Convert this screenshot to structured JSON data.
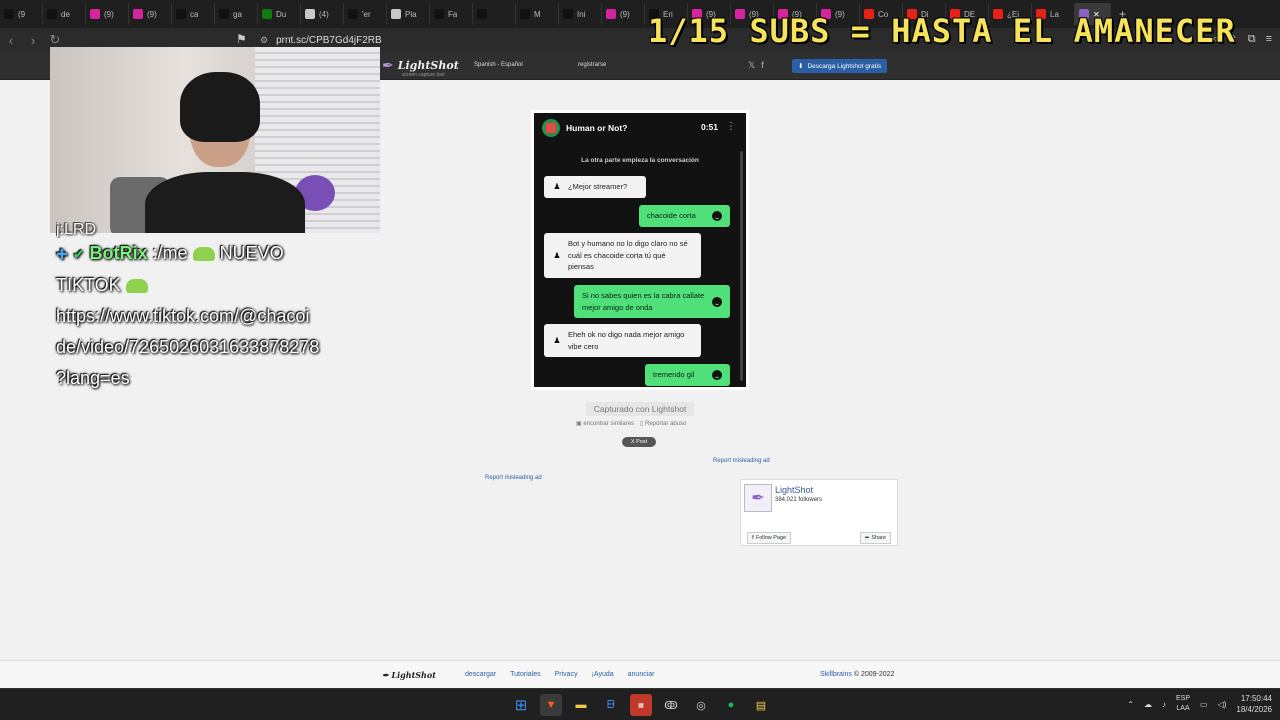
{
  "browser": {
    "tabs": [
      {
        "label": "(9",
        "icon": "tiktok-icon",
        "color": "#111111"
      },
      {
        "label": "de",
        "icon": "x-icon",
        "color": "#111111"
      },
      {
        "label": "(9)",
        "icon": "instagram-icon",
        "color": "#d6249f"
      },
      {
        "label": "(9)",
        "icon": "instagram-icon",
        "color": "#d6249f"
      },
      {
        "label": "ca",
        "icon": "x-icon",
        "color": "#111111"
      },
      {
        "label": "ga",
        "icon": "x-icon",
        "color": "#111111"
      },
      {
        "label": "Du",
        "icon": "xbox-icon",
        "color": "#107c10"
      },
      {
        "label": "(4)",
        "icon": "cloud-icon",
        "color": "#c8c8c8"
      },
      {
        "label": "'er",
        "icon": "x-icon",
        "color": "#111111"
      },
      {
        "label": "Pla",
        "icon": "cloud-icon",
        "color": "#c8c8c8"
      },
      {
        "label": "Fa",
        "icon": "x-icon",
        "color": "#111111"
      },
      {
        "label": "",
        "icon": "x-icon",
        "color": "#111111"
      },
      {
        "label": "M",
        "icon": "x-icon",
        "color": "#111111"
      },
      {
        "label": "Ini",
        "icon": "x-icon",
        "color": "#111111"
      },
      {
        "label": "(9)",
        "icon": "instagram-icon",
        "color": "#d6249f"
      },
      {
        "label": "Eri",
        "icon": "x-icon",
        "color": "#111111"
      },
      {
        "label": "(9)",
        "icon": "instagram-icon",
        "color": "#d6249f"
      },
      {
        "label": "(9)",
        "icon": "instagram-icon",
        "color": "#d6249f"
      },
      {
        "label": "(9)",
        "icon": "instagram-icon",
        "color": "#d6249f"
      },
      {
        "label": "(9)",
        "icon": "instagram-icon",
        "color": "#d6249f"
      },
      {
        "label": "Co",
        "icon": "youtube-icon",
        "color": "#e62117"
      },
      {
        "label": "Di",
        "icon": "youtube-icon",
        "color": "#e62117"
      },
      {
        "label": "DE",
        "icon": "youtube-icon",
        "color": "#e62117"
      },
      {
        "label": "¿Ei",
        "icon": "youtube-icon",
        "color": "#e62117"
      },
      {
        "label": "La",
        "icon": "youtube-icon",
        "color": "#e62117"
      }
    ],
    "url": "prnt.sc/CPB7Gd4jF2RB"
  },
  "lightshot": {
    "logo": "LightShot",
    "tagline": "screen capture tool",
    "language": "Spanish - Español",
    "register": "registrarse",
    "download_button": "Descarga Lightshot gratis",
    "captured_with": "Capturado con Lightshot",
    "find_similar": "encontrar similares",
    "report_abuse": "Reportar abuso",
    "post": "X Post",
    "report_ad_right": "Report misleading ad",
    "report_ad_left": "Report misleading ad"
  },
  "screenshot": {
    "app_title": "Human or Not?",
    "timer": "0:51",
    "intro": "La otra parte empieza la conversación",
    "messages": [
      {
        "from": "other",
        "text": "¿Mejor streamer?"
      },
      {
        "from": "me",
        "text": "chacoide corta"
      },
      {
        "from": "other",
        "text": "Bot y humano no lo digo claro no sé cuál es chacoide corta tú qué piensas"
      },
      {
        "from": "me",
        "text": "Si no sabes quien es la cabra callate mejor amigo de onda"
      },
      {
        "from": "other",
        "text": "Eheh ok no digo nada mejor amigo vibe cero"
      },
      {
        "from": "me",
        "text": "tremendo gil"
      }
    ]
  },
  "fb_widget": {
    "page_name": "LightShot",
    "followers": "384,021 followers",
    "follow": "Follow Page",
    "share": "Share"
  },
  "footer": {
    "logo": "LightShot",
    "links": [
      "descargar",
      "Tutoriales",
      "Privacy",
      "¡Ayuda",
      "anunciar"
    ],
    "company": "Skillbrains",
    "copyright": "© 2009-2022"
  },
  "overlay": {
    "sub_goal": "1/15 SUBS = HASTA EL AMANECER",
    "chat_ghost": "j:LRD",
    "chat_user": "BotRix",
    "chat_prefix": ":/me",
    "chat_word1": "NUEVO",
    "chat_word2": "TIKTOK",
    "chat_link_lines": [
      "https://www.tiktok.com/@chacoi",
      "de/video/7265026031633878278",
      "?lang=es"
    ]
  },
  "taskbar": {
    "lang_top": "ESP",
    "lang_bottom": "LAA",
    "time": "17:50:44",
    "date": "18/4/2026"
  }
}
